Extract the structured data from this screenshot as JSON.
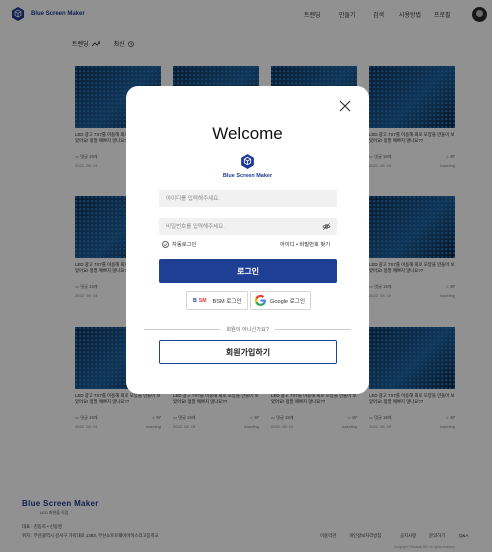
{
  "header": {
    "brand": "Blue Screen Maker",
    "nav": [
      "트렌딩",
      "만들기",
      "검색",
      "사용방법",
      "프로필"
    ]
  },
  "tabs": [
    {
      "label": "트렌딩",
      "icon": "trending-icon"
    },
    {
      "label": "최신",
      "icon": "clock-icon"
    }
  ],
  "card": {
    "title": "LED 광고 7X7를 이용해 회로 모양을 만들어 보았어요! 정말 예쁘지 않나요??",
    "comments": "댓글 19개",
    "likes": "97",
    "date": "2022. 08. 19",
    "author": "hazeling"
  },
  "modal": {
    "title": "Welcome",
    "brand": "Blue Screen Maker",
    "id_placeholder": "아이디를 입력해주세요.",
    "pw_placeholder": "비밀번호를 입력해주세요.",
    "auto_login": "자동로그인",
    "find_account": "아이디 • 비밀번호 찾기",
    "login": "로그인",
    "bsm_login": "BSM 로그인",
    "google_login": "Google 로그인",
    "not_member": "회원이 아니신가요?",
    "signup": "회원가입하기"
  },
  "footer": {
    "brand": "Blue Screen Maker",
    "sub": "LED 화면을 직접",
    "ceo": "대표 : 김동욱 • 신동영",
    "address": "위치 : 부산광역시 강서구 가락대로 1393, 부산소프트웨어마이스터고등학교",
    "links": [
      "이용약관",
      "개인정보처리방침",
      "공지사항",
      "문의하기",
      "Q&A"
    ],
    "copyright": "Copyright ©Ssulsak BM. All rights reserved."
  },
  "colors": {
    "accent": "#1f3f94",
    "brand": "#1f3a93"
  }
}
